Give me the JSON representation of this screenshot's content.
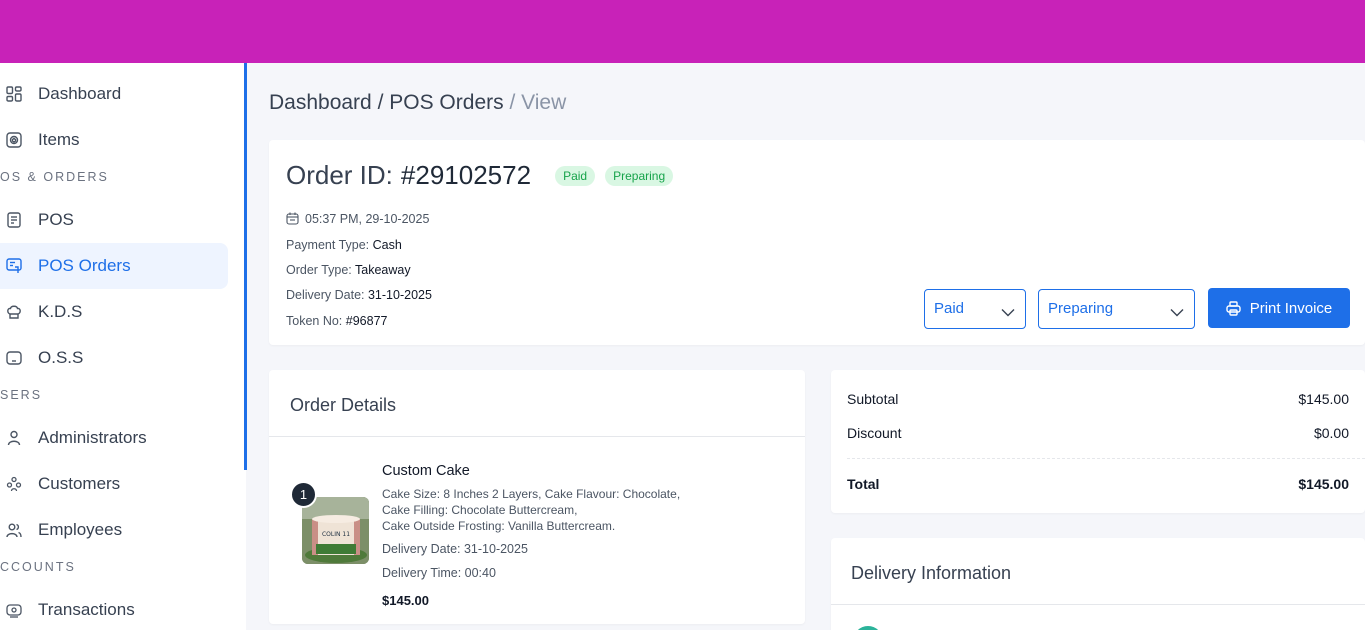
{
  "sidebar": {
    "items": [
      {
        "label": "Dashboard",
        "icon": "dashboard-icon"
      },
      {
        "label": "Items",
        "icon": "items-icon"
      },
      {
        "label": "POS",
        "icon": "pos-icon"
      },
      {
        "label": "POS Orders",
        "icon": "pos-orders-icon",
        "active": true
      },
      {
        "label": "K.D.S",
        "icon": "chef-hat-icon"
      },
      {
        "label": "O.S.S",
        "icon": "monitor-icon"
      },
      {
        "label": "Administrators",
        "icon": "user-icon"
      },
      {
        "label": "Customers",
        "icon": "customers-icon"
      },
      {
        "label": "Employees",
        "icon": "employees-icon"
      },
      {
        "label": "Transactions",
        "icon": "transactions-icon"
      }
    ],
    "sections": {
      "pos_orders": "OS & ORDERS",
      "users": "SERS",
      "accounts": "CCOUNTS"
    }
  },
  "breadcrumb": {
    "dashboard": "Dashboard",
    "sep1": " / ",
    "pos_orders": "POS Orders",
    "sep2": " / ",
    "current": "View"
  },
  "order": {
    "title_prefix": "Order ID:",
    "id": "#29102572",
    "payment_badge": "Paid",
    "status_badge": "Preparing",
    "datetime": "05:37 PM, 29-10-2025",
    "payment_type_label": "Payment Type:",
    "payment_type": "Cash",
    "order_type_label": "Order Type:",
    "order_type": "Takeaway",
    "delivery_date_label": "Delivery Date:",
    "delivery_date": "31-10-2025",
    "token_label": "Token No:",
    "token": "#96877",
    "payment_select": "Paid",
    "status_select": "Preparing",
    "print_label": "Print Invoice"
  },
  "order_details": {
    "title": "Order Details",
    "item": {
      "qty": "1",
      "name": "Custom Cake",
      "desc1": "Cake Size: 8 Inches 2 Layers, Cake Flavour: Chocolate,",
      "desc2": "Cake Filling: Chocolate Buttercream,",
      "desc3": "Cake Outside Frosting: Vanilla Buttercream.",
      "delivery_date": "Delivery Date: 31-10-2025",
      "delivery_time": "Delivery Time: 00:40",
      "price": "$145.00",
      "cake_topper_text": "COLIN 11"
    }
  },
  "summary": {
    "subtotal_label": "Subtotal",
    "subtotal": "$145.00",
    "discount_label": "Discount",
    "discount": "$0.00",
    "total_label": "Total",
    "total": "$145.00"
  },
  "delivery": {
    "title": "Delivery Information"
  },
  "colors": {
    "topbar": "#c822b8",
    "accent": "#1e6fe8",
    "badge_bg": "#d9f7e3",
    "badge_text": "#16a34a"
  }
}
